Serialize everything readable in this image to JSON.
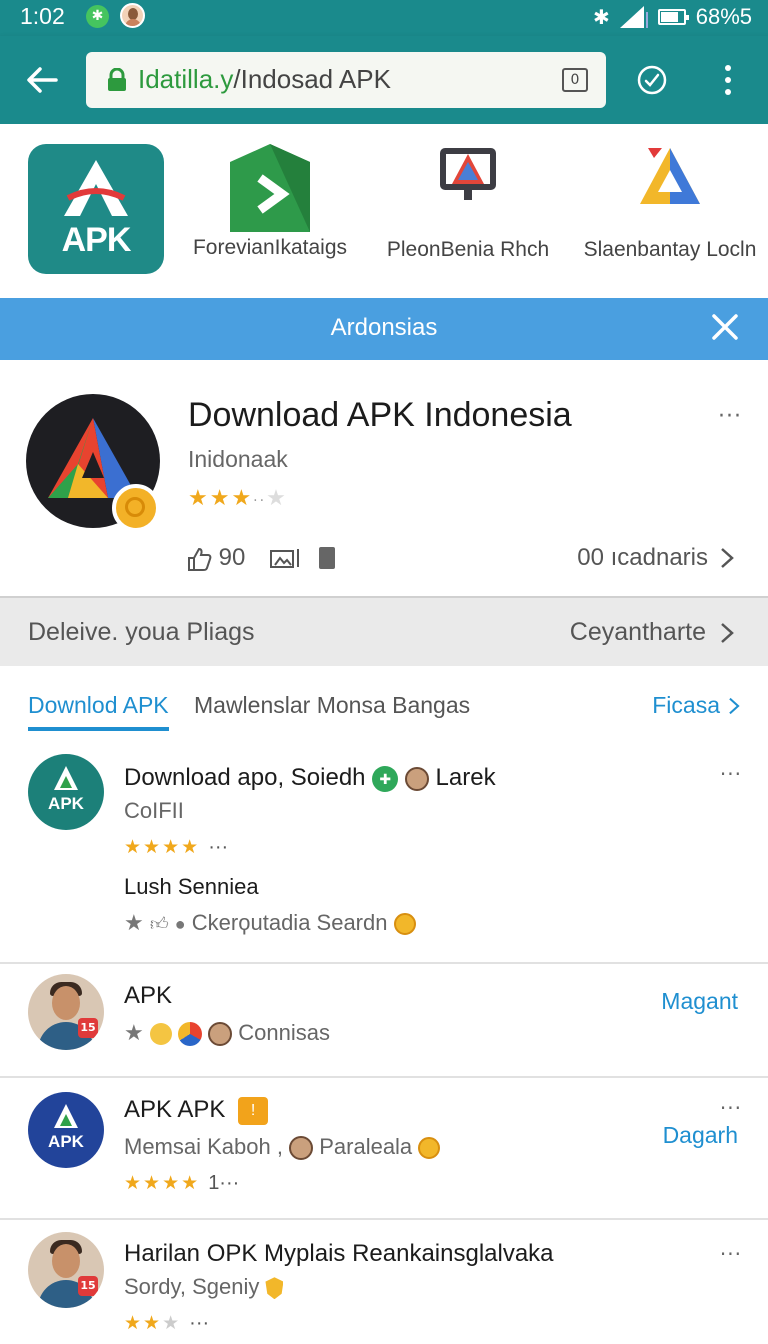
{
  "status_bar": {
    "time": "1:02",
    "battery_text": "68%5",
    "battery_level": 0.68
  },
  "browser": {
    "url_host": "Idatilla.y",
    "url_path": "/Indosad APK",
    "tabs_count": "0"
  },
  "top_apps": {
    "apk_label": "APK",
    "items": [
      {
        "name": "ForevianIkataigs"
      },
      {
        "name": "PleonBenia Rhch"
      },
      {
        "name": "Slaenbantay Locln"
      }
    ]
  },
  "banner": {
    "text": "Ardonsias"
  },
  "featured": {
    "title": "Download APK Indonesia",
    "subtitle": "Inidonaak",
    "rating": 3,
    "rating_max": 5,
    "stat_likes": "90",
    "installs": "00 ıcadnaris",
    "more": "···"
  },
  "promo": {
    "left": "Deleive. youa Pliags",
    "right": "Ceyantharte"
  },
  "tabs": {
    "active": "Downlod APK",
    "second": "Mawlenslar Monsa Bangas",
    "more": "Ficasa"
  },
  "list": [
    {
      "title": "Download apo, Soiedh",
      "title_extra": "Larek",
      "sub": "CoIFII",
      "stars": "★★★★",
      "stars_suffix": "···",
      "line2": "Lush Senniea",
      "line3": "Ckerϙutadia Seardn",
      "avatar_label": "APK"
    },
    {
      "title": "APK",
      "sub": "Connisas",
      "action": "Magant"
    },
    {
      "title": "APK APK",
      "sub_left": "Memsai Kaboh ,",
      "sub_right": "Paraleala",
      "stars": "★★★★",
      "stars_suffix": "1···",
      "action": "Dagarh",
      "avatar_label": "APK"
    },
    {
      "title": "Harilan OPK Myplais  Reankainsglalvaka",
      "sub": "Sordy, Sgeniy",
      "stars": "★★",
      "stars_dim": "★",
      "stars_suffix": "···"
    }
  ]
}
